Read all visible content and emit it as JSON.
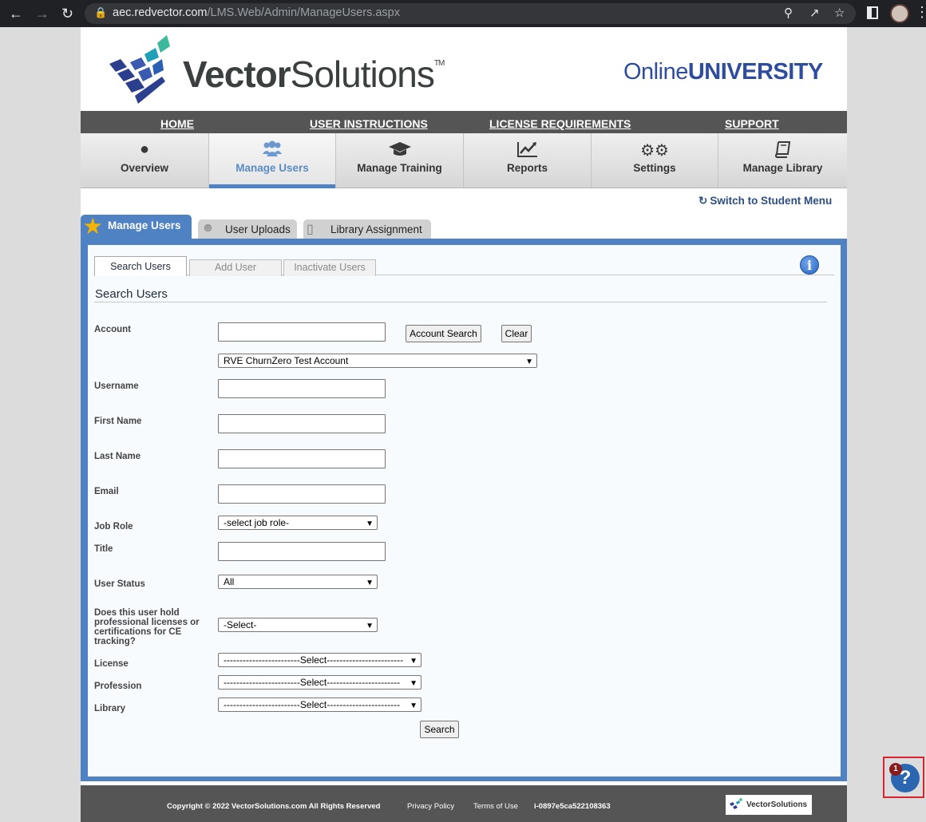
{
  "browser": {
    "url_host": "aec.redvector.com",
    "url_path": "/LMS.Web/Admin/ManageUsers.aspx",
    "icons": [
      "back-arrow-icon",
      "forward-arrow-icon",
      "reload-icon",
      "lock-icon",
      "key-icon",
      "share-icon",
      "star-icon",
      "side-panel-icon",
      "profile-avatar",
      "menu-icon"
    ]
  },
  "header": {
    "brand_bold": "Vector",
    "brand_light": "Solutions",
    "brand_tm": "TM",
    "online_prefix": "Online",
    "online_bold": "UNIVERSITY"
  },
  "topnav": {
    "home": "HOME",
    "user_instructions": "USER INSTRUCTIONS",
    "license_requirements": "LICENSE REQUIREMENTS",
    "support": "SUPPORT"
  },
  "mainnav": [
    {
      "label": "Overview",
      "icon": "globe-icon",
      "active": false
    },
    {
      "label": "Manage Users",
      "icon": "users-icon",
      "active": true
    },
    {
      "label": "Manage Training",
      "icon": "graduation-cap-icon",
      "active": false
    },
    {
      "label": "Reports",
      "icon": "line-chart-icon",
      "active": false
    },
    {
      "label": "Settings",
      "icon": "gears-icon",
      "active": false
    },
    {
      "label": "Manage Library",
      "icon": "book-icon",
      "active": false
    }
  ],
  "switch_link": "Switch to Student Menu",
  "tabs": {
    "manage_users": "Manage Users",
    "user_uploads": "User Uploads",
    "library_assignment": "Library Assignment"
  },
  "subtabs": {
    "search_users": "Search Users",
    "add_user": "Add User",
    "inactivate_users": "Inactivate Users"
  },
  "form": {
    "section_title": "Search Users",
    "account_label": "Account",
    "account_value": "",
    "account_search_button": "Account Search",
    "clear_button": "Clear",
    "account_select": "RVE ChurnZero Test Account",
    "username_label": "Username",
    "username_value": "",
    "first_name_label": "First Name",
    "first_name_value": "",
    "last_name_label": "Last Name",
    "last_name_value": "",
    "email_label": "Email",
    "email_value": "",
    "job_role_label": "Job Role",
    "job_role_select": "-select job role-",
    "title_label": "Title",
    "title_value": "",
    "user_status_label": "User Status",
    "user_status_select": "All",
    "licenses_question": "Does this user hold professional licenses or certifications for CE tracking?",
    "licenses_select": "-Select-",
    "license_label": "License",
    "license_select": "------------------------Select------------------------",
    "profession_label": "Profession",
    "profession_select": "------------------------Select-----------------------",
    "library_label": "Library",
    "library_select": "------------------------Select-----------------------",
    "search_button": "Search"
  },
  "footer": {
    "copyright": "Copyright © 2022 VectorSolutions.com All Rights Reserved",
    "privacy": "Privacy Policy",
    "terms": "Terms of Use",
    "instance_id": "i-0897e5ca522108363",
    "logo_text": "VectorSolutions"
  },
  "help": {
    "symbol": "?",
    "badge_count": "1"
  },
  "colors": {
    "accent_blue": "#4e82c2",
    "nav_gray": "#555555",
    "university_blue": "#2f4d9f",
    "help_outline": "#d9232e"
  }
}
